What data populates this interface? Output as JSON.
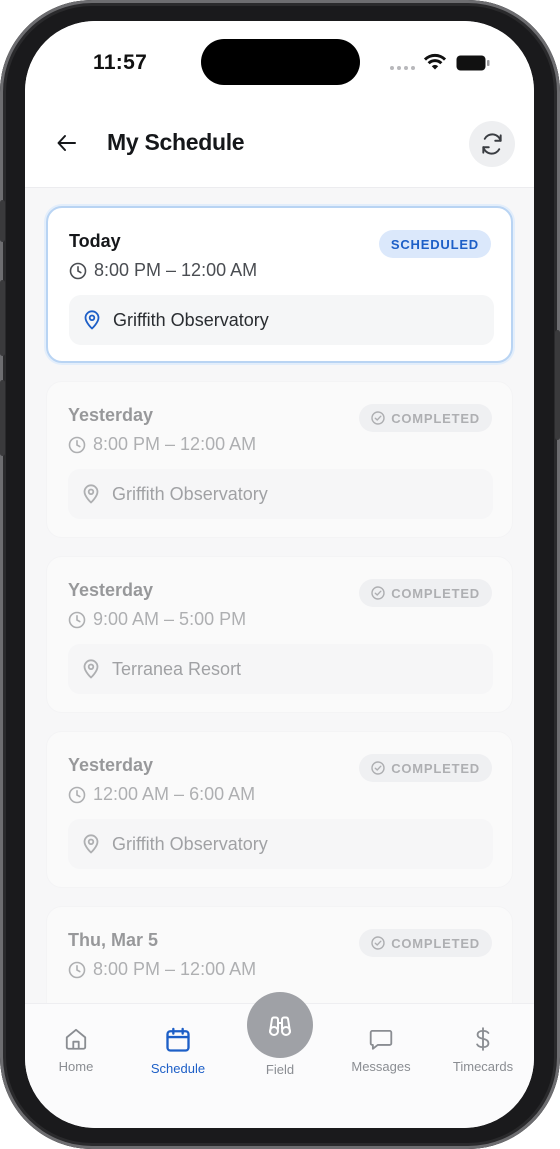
{
  "status": {
    "time": "11:57"
  },
  "header": {
    "title": "My Schedule"
  },
  "shifts": [
    {
      "day": "Today",
      "hours": "8:00 PM – 12:00 AM",
      "status": "SCHEDULED",
      "location": "Griffith Observatory"
    },
    {
      "day": "Yesterday",
      "hours": "8:00 PM – 12:00 AM",
      "status": "COMPLETED",
      "location": "Griffith Observatory"
    },
    {
      "day": "Yesterday",
      "hours": "9:00 AM – 5:00 PM",
      "status": "COMPLETED",
      "location": "Terranea Resort"
    },
    {
      "day": "Yesterday",
      "hours": "12:00 AM – 6:00 AM",
      "status": "COMPLETED",
      "location": "Griffith Observatory"
    },
    {
      "day": "Thu, Mar 5",
      "hours": "8:00 PM – 12:00 AM",
      "status": "COMPLETED",
      "location": ""
    }
  ],
  "tabs": {
    "home": "Home",
    "schedule": "Schedule",
    "field": "Field",
    "messages": "Messages",
    "timecards": "Timecards"
  },
  "colors": {
    "accent": "#1d5fc7",
    "scheduled_bg": "#dbe8fb",
    "card_border": "#b9d4f3"
  }
}
